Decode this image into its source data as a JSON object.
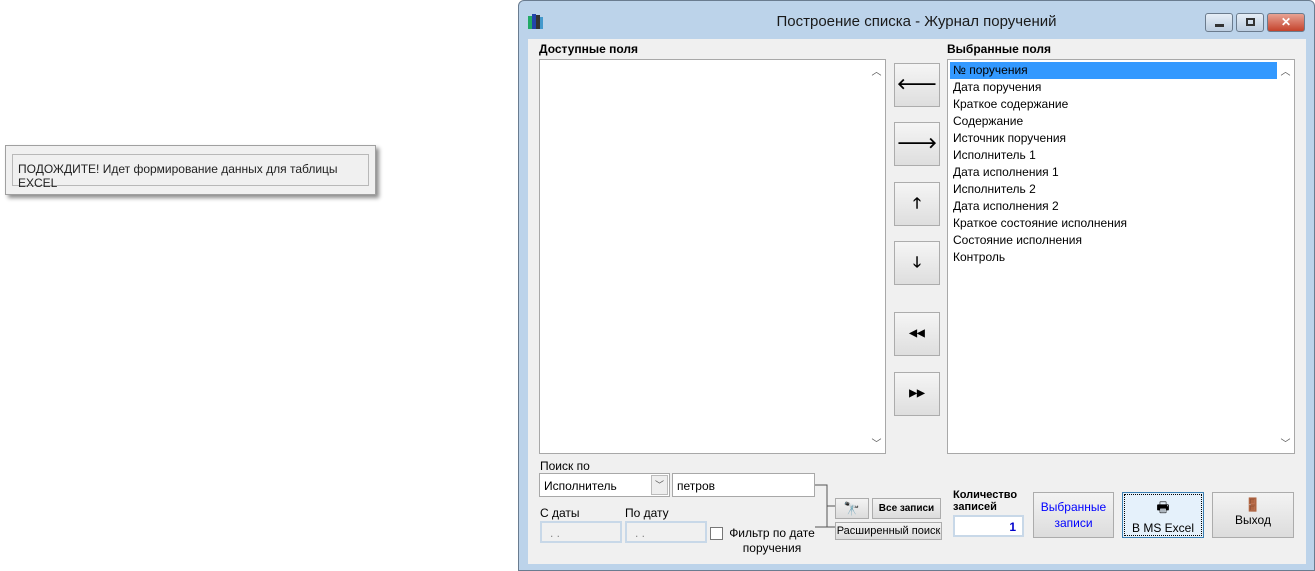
{
  "popup": {
    "message": "ПОДОЖДИТЕ! Идет формирование данных для таблицы EXCEL"
  },
  "window": {
    "title": "Построение списка - Журнал поручений"
  },
  "available": {
    "label": "Доступные поля",
    "items": []
  },
  "selected": {
    "label": "Выбранные поля",
    "items": [
      "№ поручения",
      "Дата поручения",
      "Краткое содержание",
      "Содержание",
      "Источник поручения",
      "Исполнитель 1",
      "Дата исполнения 1",
      "Исполнитель 2",
      "Дата исполнения 2",
      "Краткое состояние исполнения",
      "Состояние исполнения",
      "Контроль"
    ],
    "selected_index": 0
  },
  "arrows": {
    "left": "🡐",
    "right": "🡒",
    "up": "🡑",
    "down": "🡓",
    "all_left": "◀◀",
    "all_right": "▶▶"
  },
  "search": {
    "label": "Поиск по",
    "field": "Исполнитель",
    "value": "петров",
    "from_label": "С даты",
    "to_label": "По дату",
    "from_value": " .  .",
    "to_value": " .  .",
    "filter_label": "Фильтр по дате поручения",
    "filter_checked": false,
    "all_records": "Все записи",
    "advanced": "Расширенный поиск"
  },
  "count": {
    "label": "Количество записей",
    "value": "1"
  },
  "buttons": {
    "selected_records": "Выбранные записи",
    "excel": "В MS Excel",
    "exit": "Выход"
  },
  "colors": {
    "selection": "#3399ff",
    "link_blue": "#0000ff"
  }
}
